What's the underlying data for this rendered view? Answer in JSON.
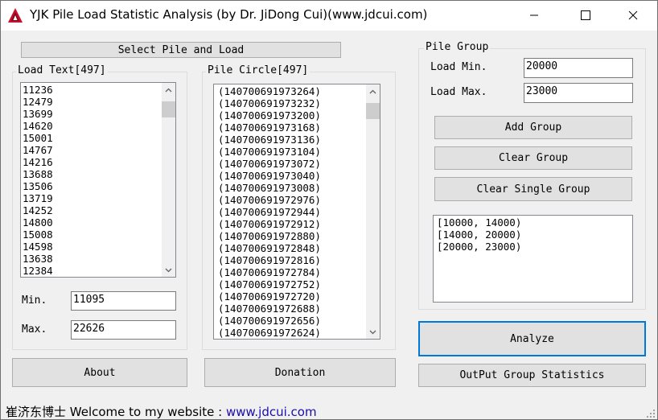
{
  "window": {
    "title": "YJK Pile Load Statistic Analysis (by Dr. JiDong Cui)(www.jdcui.com)",
    "minimize_glyph": "—",
    "maximize_glyph": "☐",
    "close_glyph": "✕",
    "icon": "autocad-triangle-icon"
  },
  "select_button": {
    "label": "Select Pile and Load"
  },
  "load_text": {
    "title": "Load Text[497]",
    "items": [
      "11236",
      "12479",
      "13699",
      "14620",
      "15001",
      "14767",
      "14216",
      "13688",
      "13506",
      "13719",
      "14252",
      "14800",
      "15008",
      "14598",
      "13638",
      "12384"
    ],
    "min_label": "Min.",
    "min_value": "11095",
    "max_label": "Max.",
    "max_value": "22626"
  },
  "pile_circle": {
    "title": "Pile Circle[497]",
    "items": [
      "(140700691973264)",
      "(140700691973232)",
      "(140700691973200)",
      "(140700691973168)",
      "(140700691973136)",
      "(140700691973104)",
      "(140700691973072)",
      "(140700691973040)",
      "(140700691973008)",
      "(140700691972976)",
      "(140700691972944)",
      "(140700691972912)",
      "(140700691972880)",
      "(140700691972848)",
      "(140700691972816)",
      "(140700691972784)",
      "(140700691972752)",
      "(140700691972720)",
      "(140700691972688)",
      "(140700691972656)",
      "(140700691972624)"
    ]
  },
  "pile_group": {
    "title": "Pile Group",
    "load_min_label": "Load Min.",
    "load_min_value": "20000",
    "load_max_label": "Load Max.",
    "load_max_value": "23000",
    "add_label": "Add Group",
    "clear_label": "Clear Group",
    "clear_single_label": "Clear Single Group",
    "groups": [
      "[10000, 14000)",
      "[14000, 20000)",
      "[20000, 23000)"
    ]
  },
  "buttons": {
    "about": "About",
    "donation": "Donation",
    "analyze": "Analyze",
    "output": "OutPut Group Statistics"
  },
  "status": {
    "prefix": "崔济东博士  Welcome to my website :",
    "link": "www.jdcui.com"
  },
  "colors": {
    "accent": "#0078d7",
    "link": "#1a0dab",
    "background": "#f0f0f0"
  }
}
